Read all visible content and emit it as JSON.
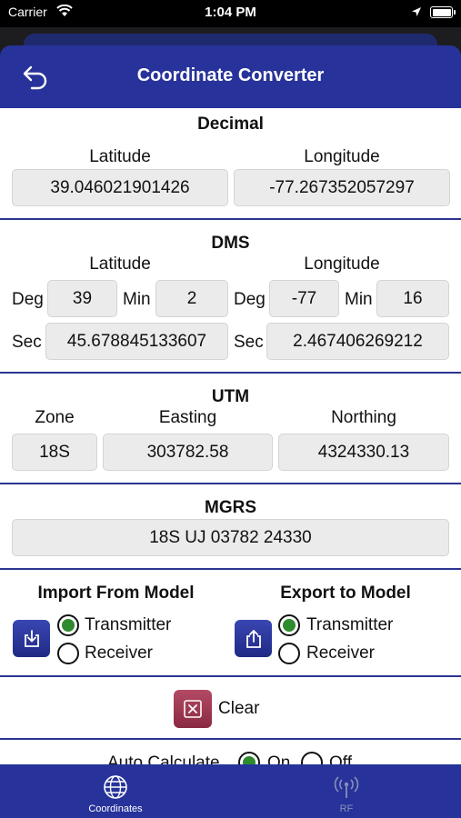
{
  "status_bar": {
    "carrier": "Carrier",
    "time": "1:04 PM"
  },
  "header": {
    "title": "Coordinate Converter"
  },
  "decimal": {
    "title": "Decimal",
    "lat_label": "Latitude",
    "lon_label": "Longitude",
    "lat_value": "39.046021901426",
    "lon_value": "-77.267352057297"
  },
  "dms": {
    "title": "DMS",
    "lat_label": "Latitude",
    "lon_label": "Longitude",
    "deg_label": "Deg",
    "min_label": "Min",
    "sec_label": "Sec",
    "lat_deg": "39",
    "lat_min": "2",
    "lat_sec": "45.678845133607",
    "lon_deg": "-77",
    "lon_min": "16",
    "lon_sec": "2.467406269212"
  },
  "utm": {
    "title": "UTM",
    "zone_label": "Zone",
    "easting_label": "Easting",
    "northing_label": "Northing",
    "zone": "18S",
    "easting": "303782.58",
    "northing": "4324330.13"
  },
  "mgrs": {
    "title": "MGRS",
    "value": "18S UJ 03782 24330"
  },
  "import": {
    "title": "Import From Model",
    "transmitter": "Transmitter",
    "receiver": "Receiver",
    "selected": "Transmitter"
  },
  "export": {
    "title": "Export to Model",
    "transmitter": "Transmitter",
    "receiver": "Receiver",
    "selected": "Transmitter"
  },
  "clear": {
    "label": "Clear"
  },
  "auto_calculate": {
    "label": "Auto Calculate",
    "on": "On",
    "off": "Off",
    "selected": "On"
  },
  "tabs": [
    {
      "label": "Coordinates",
      "icon": "globe-icon",
      "active": true
    },
    {
      "label": "RF",
      "icon": "antenna-icon",
      "active": false
    }
  ],
  "colors": {
    "primary": "#27339a",
    "radio_selected": "#2e8b2e",
    "clear_button": "#9c3550",
    "tab_inactive": "#8a8fb8"
  }
}
